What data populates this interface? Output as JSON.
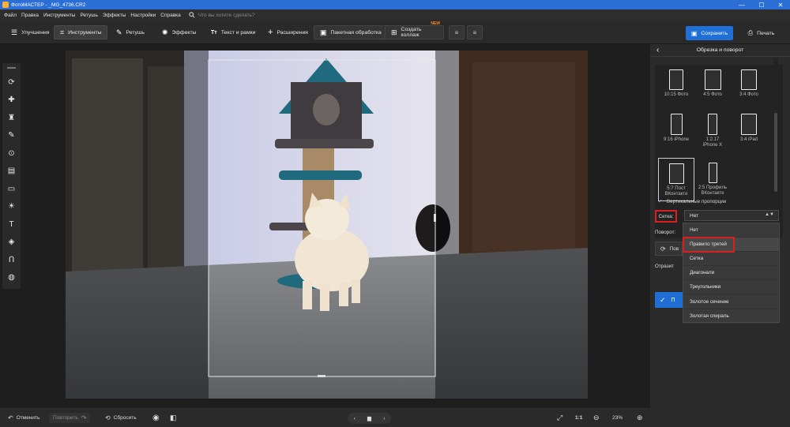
{
  "app": {
    "window_title": "ФотоМАСТЕР - _MG_4736.CR2"
  },
  "window_controls": {
    "minimize": "—",
    "maximize": "☐",
    "close": "✕"
  },
  "menu": {
    "items": [
      "Файл",
      "Правка",
      "Инструменты",
      "Ретушь",
      "Эффекты",
      "Настройки",
      "Справка"
    ],
    "search_placeholder": "Что вы хотите сделать?"
  },
  "toolbar": {
    "tabs": [
      {
        "label": "Улучшения",
        "icon": "sliders-icon",
        "glyph": "☰"
      },
      {
        "label": "Инструменты",
        "icon": "crop-icon",
        "glyph": "⌗"
      },
      {
        "label": "Ретушь",
        "icon": "brush-icon",
        "glyph": "✎"
      },
      {
        "label": "Эффекты",
        "icon": "sparkle-icon",
        "glyph": "✺"
      },
      {
        "label": "Текст и рамки",
        "icon": "text-icon",
        "glyph": "Tт"
      },
      {
        "label": "Расширения",
        "icon": "plus-icon",
        "glyph": "+"
      }
    ],
    "batch_label": "Пакетная обработка",
    "collage_label": "Создать коллаж",
    "collage_badge": "NEW",
    "save_label": "Сохранить",
    "print_label": "Печать"
  },
  "left_tools": [
    {
      "icon": "rotate-icon",
      "glyph": "⟳"
    },
    {
      "icon": "healing-patch-icon",
      "glyph": "✚"
    },
    {
      "icon": "stamp-icon",
      "glyph": "♜"
    },
    {
      "icon": "brush-icon",
      "glyph": "✎"
    },
    {
      "icon": "radial-filter-icon",
      "glyph": "⊙"
    },
    {
      "icon": "gradient-filter-icon",
      "glyph": "▤"
    },
    {
      "icon": "vignette-icon",
      "glyph": "▭"
    },
    {
      "icon": "light-icon",
      "glyph": "☀"
    },
    {
      "icon": "text-icon",
      "glyph": "T"
    },
    {
      "icon": "fill-icon",
      "glyph": "◈"
    },
    {
      "icon": "magnet-icon",
      "glyph": "Ո"
    },
    {
      "icon": "globe-icon",
      "glyph": "◍"
    }
  ],
  "bottom_bar": {
    "undo_label": "Отменить",
    "redo_label": "Повторить",
    "reset_label": "Сбросить",
    "fit_label": "1:1",
    "zoom": "23%"
  },
  "crop_panel": {
    "title": "Обрезка и поворот",
    "ratios": [
      {
        "label": "10:15 Фото"
      },
      {
        "label": "4:5 Фото"
      },
      {
        "label": "3:4 Фото"
      },
      {
        "label": "9:16 iPhone"
      },
      {
        "label": "1:2.17\niPhone X"
      },
      {
        "label": "3:4 iPad"
      },
      {
        "label": "5:7 Пост\nВКонтакте",
        "selected": true
      },
      {
        "label": "2:5 Профиль\nВКонтакте"
      }
    ],
    "vertical_label": "Вертикальные пропорции",
    "grid_label": "Сетка:",
    "grid_value": "Нет",
    "rotation_label": "Поворот:",
    "rotate_button": "Пов",
    "reflect_label": "Отразит",
    "apply_label": "П",
    "grid_options": [
      {
        "label": "Нет"
      },
      {
        "label": "Правило третей",
        "highlighted": true
      },
      {
        "label": "Сетка"
      },
      {
        "label": "Диагонали"
      },
      {
        "label": "Треугольники"
      },
      {
        "label": "Золотое сечение"
      },
      {
        "label": "Золотая спираль"
      }
    ]
  },
  "colors": {
    "accent": "#1f6fd6",
    "title_bar": "#2b6fd6",
    "highlight_red": "#d91f1f",
    "panel_bg": "#2b2b2b"
  }
}
